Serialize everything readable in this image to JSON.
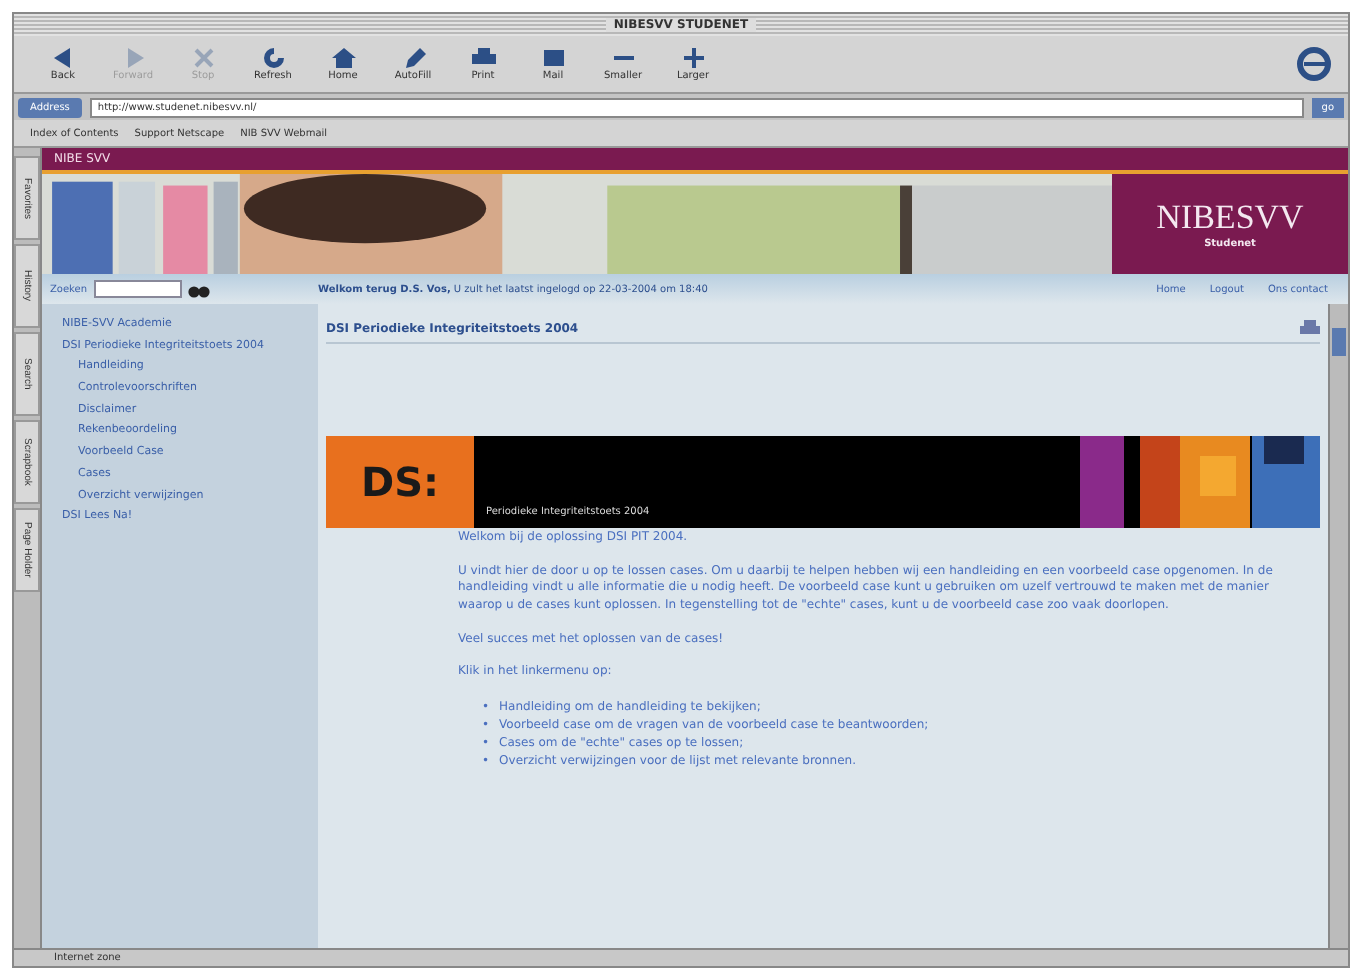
{
  "window": {
    "title": "NIBESVV STUDENET"
  },
  "toolbar": [
    {
      "label": "Back",
      "kind": "back",
      "disabled": false
    },
    {
      "label": "Forward",
      "kind": "forward",
      "disabled": true
    },
    {
      "label": "Stop",
      "kind": "stop",
      "disabled": true
    },
    {
      "label": "Refresh",
      "kind": "refresh",
      "disabled": false
    },
    {
      "label": "Home",
      "kind": "home",
      "disabled": false
    },
    {
      "label": "AutoFill",
      "kind": "pen",
      "disabled": false
    },
    {
      "label": "Print",
      "kind": "print",
      "disabled": false
    },
    {
      "label": "Mail",
      "kind": "mail",
      "disabled": false
    },
    {
      "label": "Smaller",
      "kind": "minus",
      "disabled": false
    },
    {
      "label": "Larger",
      "kind": "plus",
      "disabled": false
    }
  ],
  "address": {
    "label": "Address",
    "value": "http://www.studenet.nibesvv.nl/",
    "go": "go"
  },
  "favorites": [
    "Index of Contents",
    "Support Netscape",
    "NIB SVV Webmail"
  ],
  "side_tabs": [
    "Favorites",
    "History",
    "Search",
    "Scrapbook",
    "Page Holder"
  ],
  "site": {
    "bar_title": "NIBE SVV",
    "logo": "NIBESVV",
    "logo_sub": "Studenet",
    "search_label": "Zoeken",
    "welcome": "**Welkom terug D.S. Vos,** U zult het laatst ingelogd op 22-03-2004 om 18:40",
    "links": [
      "Home",
      "Logout",
      "Ons contact"
    ],
    "nav": [
      {
        "label": "NIBE-SVV Academie"
      },
      {
        "label": "DSI Periodieke Integriteitstoets 2004",
        "children": [
          {
            "label": "Handleiding"
          },
          {
            "label": "Controlevoorschriften"
          },
          {
            "label": "Disclaimer"
          },
          {
            "label": "Rekenbeoordeling"
          },
          {
            "label": "Voorbeeld Case"
          },
          {
            "label": "Cases"
          },
          {
            "label": "Overzicht verwijzingen"
          }
        ]
      },
      {
        "label": "DSI Lees Na!"
      }
    ],
    "page_title": "DSI Periodieke Integriteitstoets 2004",
    "banner_logo": "DS:",
    "banner_caption": "Periodieke Integriteitstoets 2004",
    "paragraphs": [
      "Welkom bij de oplossing DSI PIT 2004.",
      "U vindt hier de door u op te lossen cases. Om u daarbij te helpen hebben wij een handleiding en een voorbeeld case opgenomen. In de handleiding vindt u alle informatie die u nodig heeft. De voorbeeld case kunt u gebruiken om uzelf vertrouwd te maken met de manier waarop u de cases kunt oplossen. In tegenstelling tot de \"echte\" cases, kunt u de voorbeeld case zoo vaak doorlopen.",
      "Veel succes met het oplossen van de cases!",
      "Klik in het linkermenu op:"
    ],
    "bullets": [
      {
        "marker": "•",
        "text": "Handleiding om de handleiding te bekijken;"
      },
      {
        "marker": "•",
        "text": "Voorbeeld case om de vragen van de voorbeeld case te beantwoorden;"
      },
      {
        "marker": "•",
        "text": "Cases om de \"echte\" cases op te lossen;"
      },
      {
        "marker": "•",
        "text": "Overzicht verwijzingen voor de lijst met relevante bronnen."
      }
    ]
  },
  "status_bar": "Internet zone"
}
